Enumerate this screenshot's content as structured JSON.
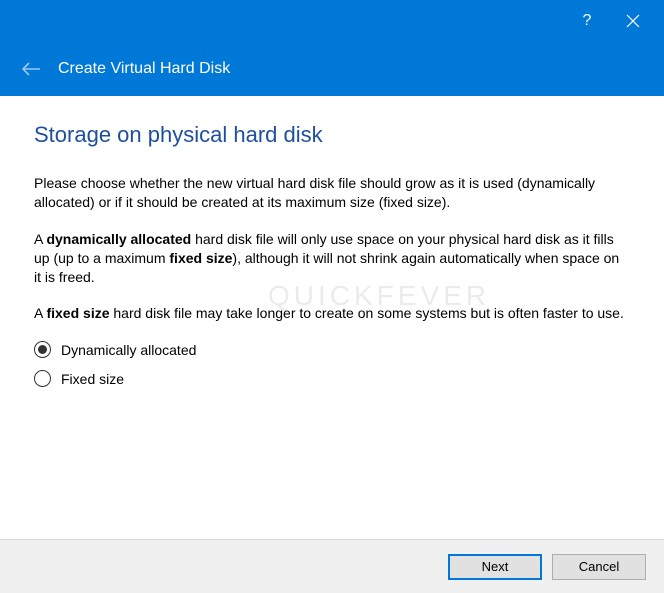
{
  "titlebar": {
    "help": "?",
    "close": "close"
  },
  "header": {
    "title": "Create Virtual Hard Disk"
  },
  "page": {
    "title": "Storage on physical hard disk",
    "para1": "Please choose whether the new virtual hard disk file should grow as it is used (dynamically allocated) or if it should be created at its maximum size (fixed size).",
    "para2_pre": "A ",
    "para2_b1": "dynamically allocated",
    "para2_mid": " hard disk file will only use space on your physical hard disk as it fills up (up to a maximum ",
    "para2_b2": "fixed size",
    "para2_post": "), although it will not shrink again automatically when space on it is freed.",
    "para3_pre": "A ",
    "para3_b": "fixed size",
    "para3_post": " hard disk file may take longer to create on some systems but is often faster to use."
  },
  "options": {
    "dynamic": "Dynamically allocated",
    "fixed": "Fixed size",
    "selected": "dynamic"
  },
  "footer": {
    "next": "Next",
    "cancel": "Cancel"
  },
  "watermark": "QUICKFEVER"
}
